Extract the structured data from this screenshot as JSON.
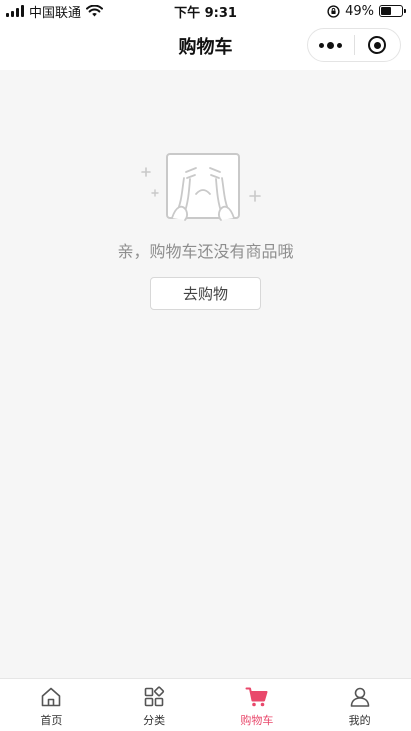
{
  "status_bar": {
    "carrier": "中国联通",
    "time": "下午 9:31",
    "battery_percent": "49%",
    "battery_level": 0.49
  },
  "nav": {
    "title": "购物车"
  },
  "empty_state": {
    "message": "亲，购物车还没有商品哦",
    "button_label": "去购物"
  },
  "tabs": [
    {
      "label": "首页",
      "icon": "home-icon",
      "active": false
    },
    {
      "label": "分类",
      "icon": "category-icon",
      "active": false
    },
    {
      "label": "购物车",
      "icon": "cart-icon",
      "active": true
    },
    {
      "label": "我的",
      "icon": "user-icon",
      "active": false
    }
  ],
  "colors": {
    "accent": "#e9486b",
    "page_background": "#f6f6f6",
    "muted_text": "#8e8e8e"
  }
}
